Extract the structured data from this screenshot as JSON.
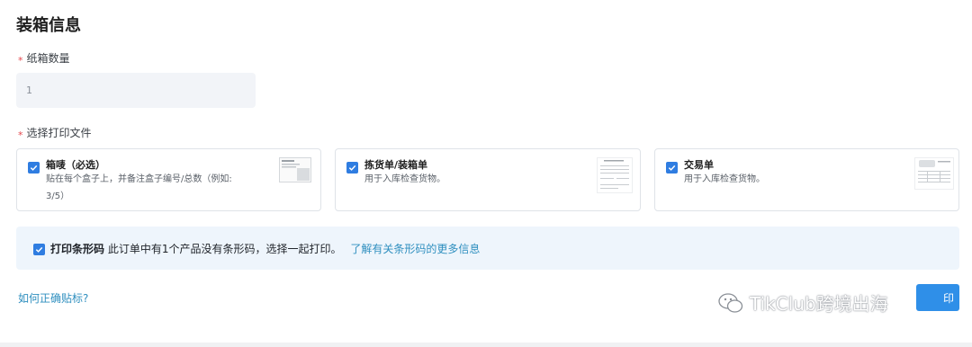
{
  "section": {
    "title": "装箱信息"
  },
  "carton_qty": {
    "label": "纸箱数量",
    "required_mark": "*",
    "value": "1"
  },
  "print_files": {
    "label": "选择打印文件",
    "required_mark": "*",
    "cards": [
      {
        "title": "箱唛（必选）",
        "desc_line1": "贴在每个盒子上，并备注盒子编号/总数（例如:",
        "desc_line2": "3/5）",
        "checked": true
      },
      {
        "title": "拣货单/装箱单",
        "desc_line1": "用于入库检查货物。",
        "checked": true
      },
      {
        "title": "交易单",
        "desc_line1": "用于入库检查货物。",
        "checked": true
      }
    ]
  },
  "barcode": {
    "checked": true,
    "bold_label": "打印条形码",
    "text": "此订单中有1个产品没有条形码，选择一起打印。",
    "link": "了解有关条形码的更多信息"
  },
  "help_link": "如何正确贴标?",
  "print_button": "印",
  "watermark": "TikClub跨境出海",
  "colors": {
    "primary": "#2f7de1",
    "link": "#2f8fbf",
    "required": "#e5484d",
    "info_bg": "#eef5fc"
  }
}
